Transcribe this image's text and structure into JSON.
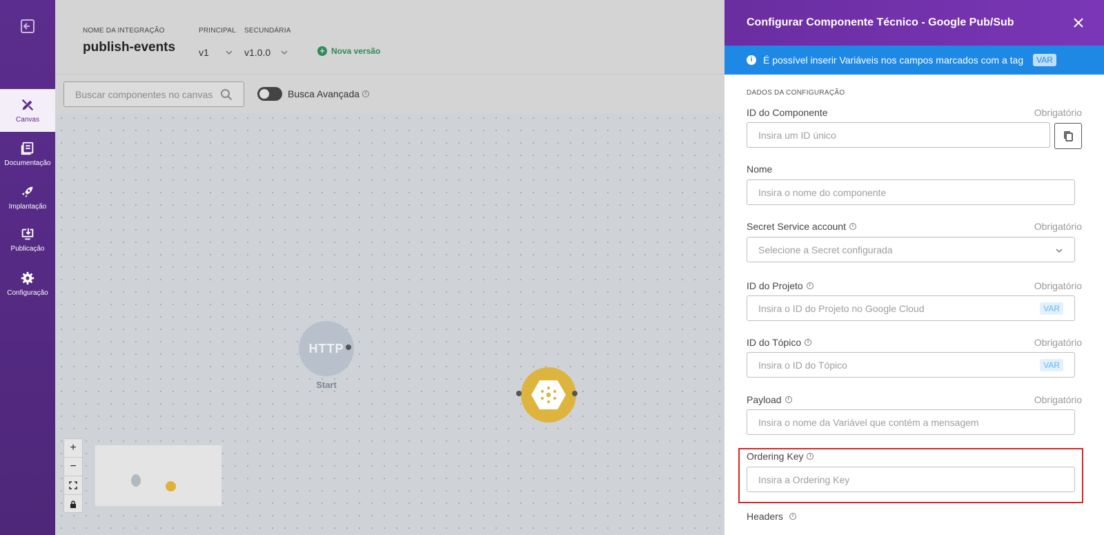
{
  "sidebar": {
    "items": [
      {
        "label": "Canvas",
        "icon": "canvas-icon",
        "active": true
      },
      {
        "label": "Documentação",
        "icon": "book-icon"
      },
      {
        "label": "Implantação",
        "icon": "rocket-icon"
      },
      {
        "label": "Publicação",
        "icon": "publish-icon"
      },
      {
        "label": "Configuração",
        "icon": "gear-icon"
      }
    ]
  },
  "header": {
    "integration_label": "NOME DA INTEGRAÇÃO",
    "integration_name": "publish-events",
    "primary_label": "PRINCIPAL",
    "primary_value": "v1",
    "secondary_label": "SECUNDÁRIA",
    "secondary_value": "v1.0.0",
    "new_version": "Nova versão"
  },
  "canvas": {
    "search_placeholder": "Buscar componentes no canvas",
    "advanced_search": "Busca Avançada",
    "http_node_text": "HTTP",
    "http_node_label": "Start"
  },
  "panel": {
    "title": "Configurar Componente Técnico - Google Pub/Sub",
    "info": "É possível inserir Variáveis nos campos marcados com a tag",
    "var_tag": "VAR",
    "section_title": "DADOS DA CONFIGURAÇÃO",
    "required": "Obrigatório",
    "fields": {
      "component_id": {
        "label": "ID do Componente",
        "placeholder": "Insira um ID único"
      },
      "name": {
        "label": "Nome",
        "placeholder": "Insira o nome do componente"
      },
      "secret": {
        "label": "Secret Service account",
        "placeholder": "Selecione a Secret configurada"
      },
      "project_id": {
        "label": "ID do Projeto",
        "placeholder": "Insira o ID do Projeto no Google Cloud"
      },
      "topic_id": {
        "label": "ID do Tópico",
        "placeholder": "Insira o ID do Tópico"
      },
      "payload": {
        "label": "Payload",
        "placeholder": "Insira o nome da Variável que contém a mensagem"
      },
      "ordering_key": {
        "label": "Ordering Key",
        "placeholder": "Insira a Ordering Key"
      },
      "headers": {
        "label": "Headers"
      }
    }
  },
  "colors": {
    "sidebar": "#5b2d8e",
    "panel_header": "#6a2ea0",
    "info_bar": "#1e88e5",
    "highlight": "#e02020",
    "pubsub_node": "#ddb53e"
  }
}
